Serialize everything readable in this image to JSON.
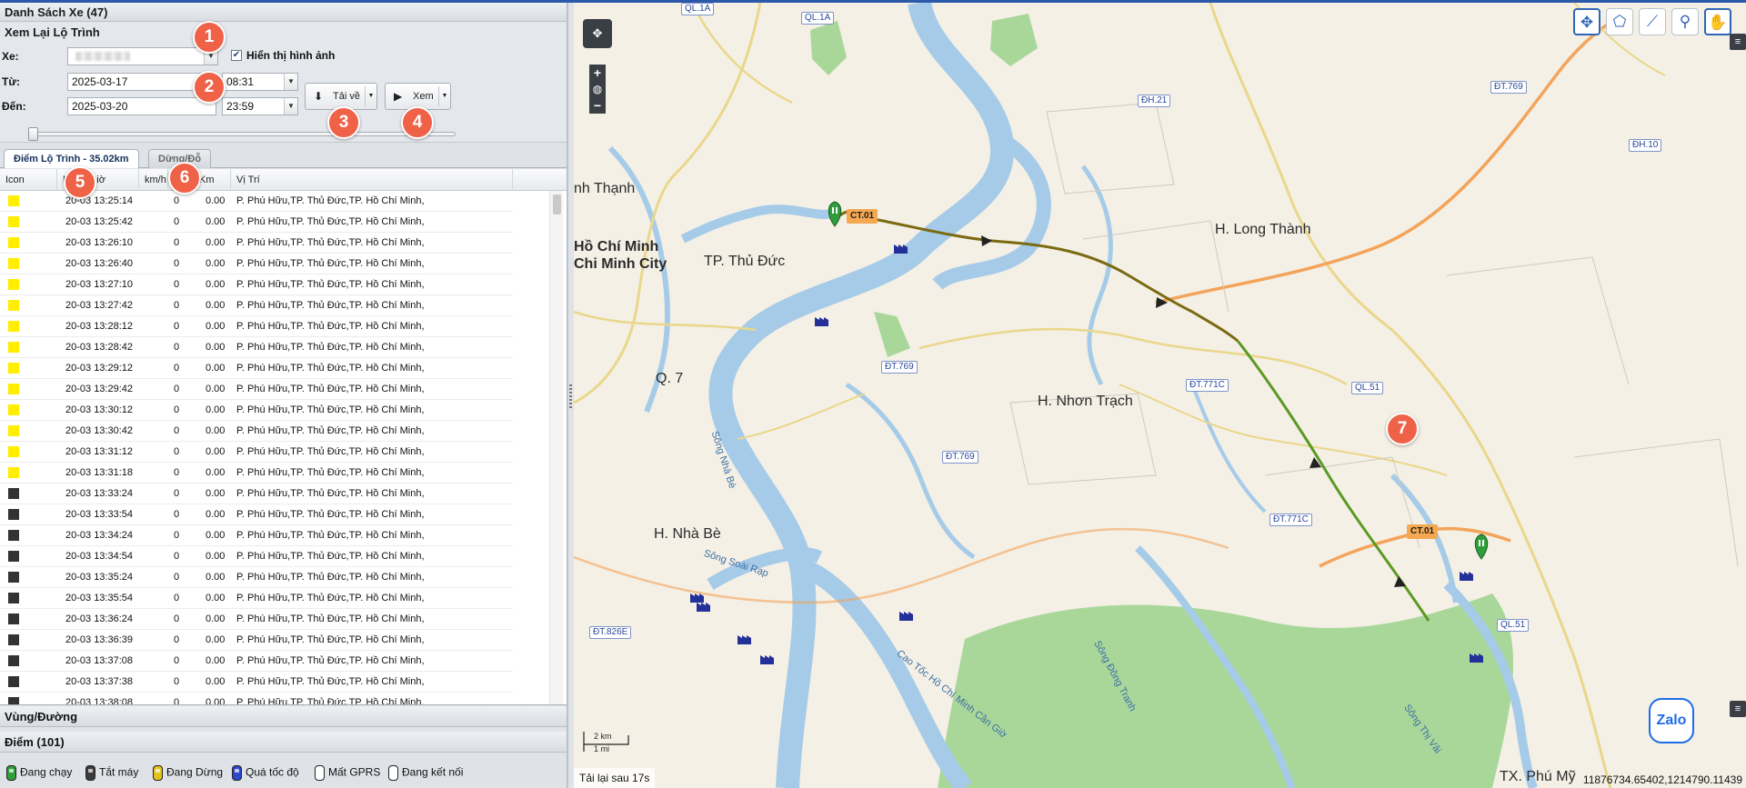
{
  "panel": {
    "vehicle_list_title": "Danh Sách Xe (47)",
    "route_review_title": "Xem Lại Lộ Trình",
    "vehicle_label": "Xe:",
    "show_images_label": "Hiển thị hình ảnh",
    "show_images_checked": true,
    "from_label": "Từ:",
    "to_label": "Đến:",
    "from_date": "2025-03-17",
    "from_time": "08:31",
    "to_date": "2025-03-20",
    "to_time": "23:59",
    "download_label": "Tải về",
    "view_label": "Xem",
    "slider_value": 0
  },
  "tabs": {
    "route_points": "Điểm Lộ Trình - 35.02km",
    "stops": "Dừng/Đỗ"
  },
  "table": {
    "columns": [
      "Icon",
      "Ngày/Giờ",
      "km/h",
      "Km",
      "Vị Trí"
    ],
    "rows": [
      {
        "status": "yellow",
        "datetime": "20-03 13:25:14",
        "speed": "0",
        "km": "0.00",
        "location": "P. Phú Hữu,TP. Thủ Đức,TP. Hồ Chí Minh,"
      },
      {
        "status": "yellow",
        "datetime": "20-03 13:25:42",
        "speed": "0",
        "km": "0.00",
        "location": "P. Phú Hữu,TP. Thủ Đức,TP. Hồ Chí Minh,"
      },
      {
        "status": "yellow",
        "datetime": "20-03 13:26:10",
        "speed": "0",
        "km": "0.00",
        "location": "P. Phú Hữu,TP. Thủ Đức,TP. Hồ Chí Minh,"
      },
      {
        "status": "yellow",
        "datetime": "20-03 13:26:40",
        "speed": "0",
        "km": "0.00",
        "location": "P. Phú Hữu,TP. Thủ Đức,TP. Hồ Chí Minh,"
      },
      {
        "status": "yellow",
        "datetime": "20-03 13:27:10",
        "speed": "0",
        "km": "0.00",
        "location": "P. Phú Hữu,TP. Thủ Đức,TP. Hồ Chí Minh,"
      },
      {
        "status": "yellow",
        "datetime": "20-03 13:27:42",
        "speed": "0",
        "km": "0.00",
        "location": "P. Phú Hữu,TP. Thủ Đức,TP. Hồ Chí Minh,"
      },
      {
        "status": "yellow",
        "datetime": "20-03 13:28:12",
        "speed": "0",
        "km": "0.00",
        "location": "P. Phú Hữu,TP. Thủ Đức,TP. Hồ Chí Minh,"
      },
      {
        "status": "yellow",
        "datetime": "20-03 13:28:42",
        "speed": "0",
        "km": "0.00",
        "location": "P. Phú Hữu,TP. Thủ Đức,TP. Hồ Chí Minh,"
      },
      {
        "status": "yellow",
        "datetime": "20-03 13:29:12",
        "speed": "0",
        "km": "0.00",
        "location": "P. Phú Hữu,TP. Thủ Đức,TP. Hồ Chí Minh,"
      },
      {
        "status": "yellow",
        "datetime": "20-03 13:29:42",
        "speed": "0",
        "km": "0.00",
        "location": "P. Phú Hữu,TP. Thủ Đức,TP. Hồ Chí Minh,"
      },
      {
        "status": "yellow",
        "datetime": "20-03 13:30:12",
        "speed": "0",
        "km": "0.00",
        "location": "P. Phú Hữu,TP. Thủ Đức,TP. Hồ Chí Minh,"
      },
      {
        "status": "yellow",
        "datetime": "20-03 13:30:42",
        "speed": "0",
        "km": "0.00",
        "location": "P. Phú Hữu,TP. Thủ Đức,TP. Hồ Chí Minh,"
      },
      {
        "status": "yellow",
        "datetime": "20-03 13:31:12",
        "speed": "0",
        "km": "0.00",
        "location": "P. Phú Hữu,TP. Thủ Đức,TP. Hồ Chí Minh,"
      },
      {
        "status": "yellow",
        "datetime": "20-03 13:31:18",
        "speed": "0",
        "km": "0.00",
        "location": "P. Phú Hữu,TP. Thủ Đức,TP. Hồ Chí Minh,"
      },
      {
        "status": "black",
        "datetime": "20-03 13:33:24",
        "speed": "0",
        "km": "0.00",
        "location": "P. Phú Hữu,TP. Thủ Đức,TP. Hồ Chí Minh,"
      },
      {
        "status": "black",
        "datetime": "20-03 13:33:54",
        "speed": "0",
        "km": "0.00",
        "location": "P. Phú Hữu,TP. Thủ Đức,TP. Hồ Chí Minh,"
      },
      {
        "status": "black",
        "datetime": "20-03 13:34:24",
        "speed": "0",
        "km": "0.00",
        "location": "P. Phú Hữu,TP. Thủ Đức,TP. Hồ Chí Minh,"
      },
      {
        "status": "black",
        "datetime": "20-03 13:34:54",
        "speed": "0",
        "km": "0.00",
        "location": "P. Phú Hữu,TP. Thủ Đức,TP. Hồ Chí Minh,"
      },
      {
        "status": "black",
        "datetime": "20-03 13:35:24",
        "speed": "0",
        "km": "0.00",
        "location": "P. Phú Hữu,TP. Thủ Đức,TP. Hồ Chí Minh,"
      },
      {
        "status": "black",
        "datetime": "20-03 13:35:54",
        "speed": "0",
        "km": "0.00",
        "location": "P. Phú Hữu,TP. Thủ Đức,TP. Hồ Chí Minh,"
      },
      {
        "status": "black",
        "datetime": "20-03 13:36:24",
        "speed": "0",
        "km": "0.00",
        "location": "P. Phú Hữu,TP. Thủ Đức,TP. Hồ Chí Minh,"
      },
      {
        "status": "black",
        "datetime": "20-03 13:36:39",
        "speed": "0",
        "km": "0.00",
        "location": "P. Phú Hữu,TP. Thủ Đức,TP. Hồ Chí Minh,"
      },
      {
        "status": "black",
        "datetime": "20-03 13:37:08",
        "speed": "0",
        "km": "0.00",
        "location": "P. Phú Hữu,TP. Thủ Đức,TP. Hồ Chí Minh,"
      },
      {
        "status": "black",
        "datetime": "20-03 13:37:38",
        "speed": "0",
        "km": "0.00",
        "location": "P. Phú Hữu,TP. Thủ Đức,TP. Hồ Chí Minh,"
      },
      {
        "status": "black",
        "datetime": "20-03 13:38:08",
        "speed": "0",
        "km": "0.00",
        "location": "P. Phú Hữu,TP. Thủ Đức,TP. Hồ Chí Minh,"
      }
    ]
  },
  "accordion": {
    "zones": "Vùng/Đường",
    "points": "Điểm (101)"
  },
  "legend": [
    {
      "label": "Đang chạy",
      "color": "#2f9e3a"
    },
    {
      "label": "Tắt máy",
      "color": "#3b3b3b"
    },
    {
      "label": "Đang Dừng",
      "color": "#e3c21a"
    },
    {
      "label": "Quá tốc độ",
      "color": "#2d48c8"
    },
    {
      "label": "Mất GPRS",
      "color": "#ffffff"
    },
    {
      "label": "Đang kết nối",
      "color": "#ffffff"
    }
  ],
  "badges": [
    "1",
    "2",
    "3",
    "4",
    "5",
    "6",
    "7"
  ],
  "map": {
    "labels": {
      "thu_duc": "TP. Thủ Đức",
      "binh_thanh": "nh Thạnh",
      "hcm_vn": "Hồ Chí Minh",
      "hcm_en": "Chi Minh City",
      "long_thanh": "H. Long Thành",
      "nhon_trach": "H. Nhơn Trạch",
      "q7": "Q. 7",
      "nha_be": "H. Nhà Bè",
      "phu_my": "TX. Phú Mỹ",
      "song_nha_be": "Sông Nhà Bè",
      "song_soai_rap": "Sông Soài Rạp",
      "song_dong_tranh": "Sông Đồng Tranh",
      "song_thi_vai": "Sông Thị Vải",
      "cao_toc": "Cao Tốc Hồ Chí Minh Cần Giờ"
    },
    "shields": {
      "ql1a_a": "QL.1A",
      "ql1a_b": "QL.1A",
      "dt769_a": "ĐT.769",
      "dh21": "ĐH.21",
      "dh10": "ĐH.10",
      "dt769_b": "ĐT.769",
      "dt769_c": "ĐT.769",
      "dt771c_a": "ĐT.771C",
      "dt771c_b": "ĐT.771C",
      "ql51_a": "QL.51",
      "ql51_b": "QL.51",
      "dt826e": "ĐT.826E"
    },
    "ct01": "CT.01",
    "scale_km": "2 km",
    "scale_mi": "1 mi",
    "status_text": "Tải lại sau 17s",
    "coordinates": "11876734.65402,1214790.11439",
    "zalo": "Zalo",
    "colors": {
      "water": "#a6cbe8",
      "land": "#f4f0e6",
      "green": "#a9d79a",
      "route_dark": "#7b6a12",
      "route_green": "#5a9a22",
      "expressway": "#f4a45a"
    }
  }
}
